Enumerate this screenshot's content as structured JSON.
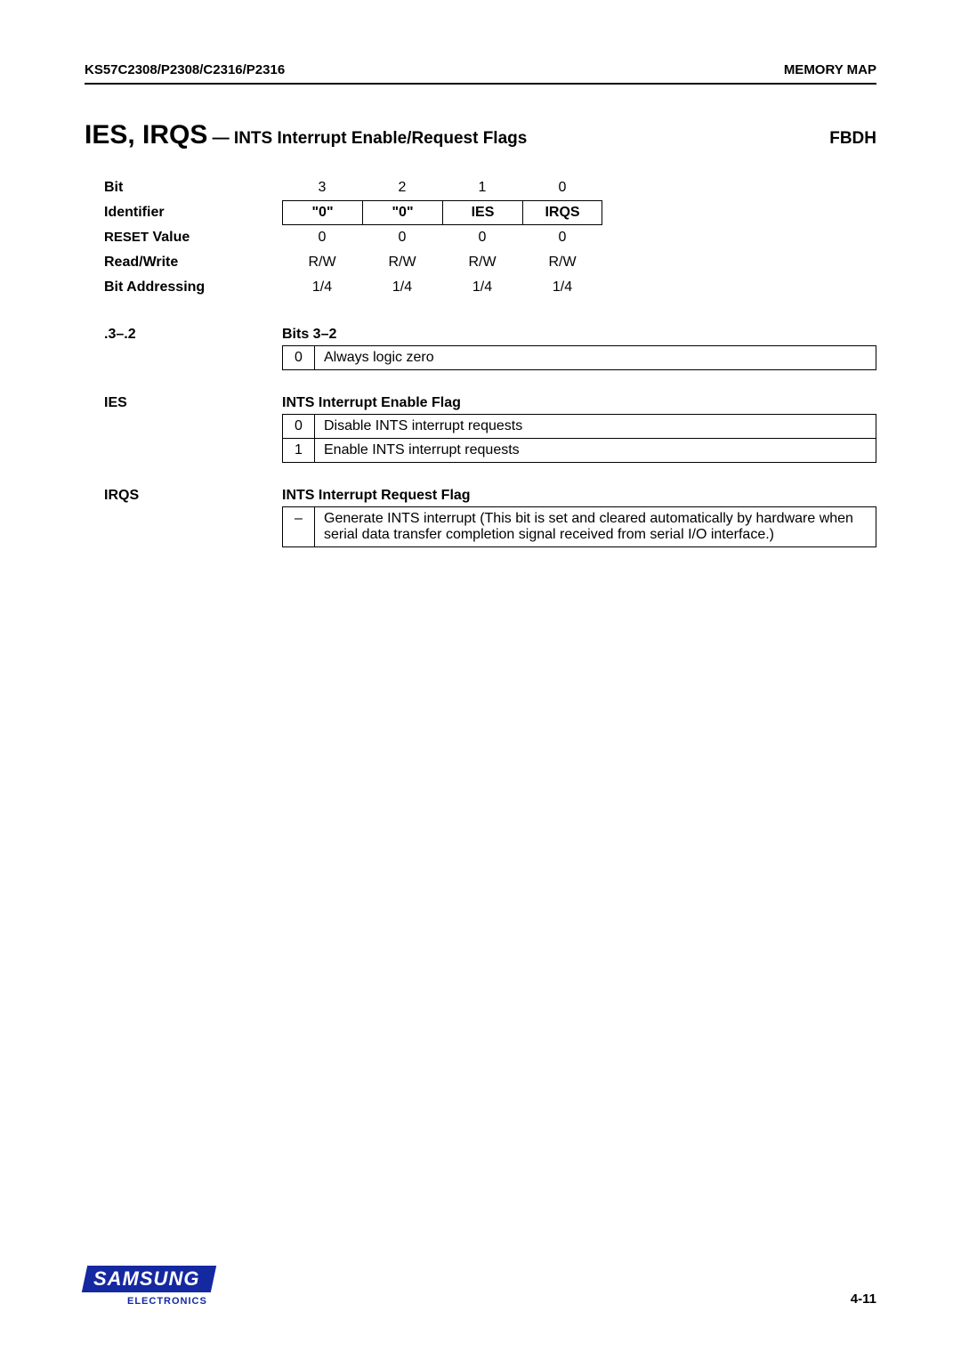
{
  "header": {
    "left": "KS57C2308/P2308/C2316/P2316",
    "right": "MEMORY MAP"
  },
  "title": {
    "big": "IES, IRQS",
    "sub": " — INTS Interrupt Enable/Request Flags",
    "addr": "FBDH"
  },
  "bit_table": {
    "rows": [
      {
        "label": "Bit",
        "cells": [
          "3",
          "2",
          "1",
          "0"
        ]
      },
      {
        "label": "Identifier",
        "cells": [
          "\"0\"",
          "\"0\"",
          "IES",
          "IRQS"
        ]
      },
      {
        "label_reset": "RESET",
        "label_value": " Value",
        "cells": [
          "0",
          "0",
          "0",
          "0"
        ]
      },
      {
        "label": "Read/Write",
        "cells": [
          "R/W",
          "R/W",
          "R/W",
          "R/W"
        ]
      },
      {
        "label": "Bit Addressing",
        "cells": [
          "1/4",
          "1/4",
          "1/4",
          "1/4"
        ]
      }
    ]
  },
  "sections": [
    {
      "key": ".3–.2",
      "title": "Bits 3–2",
      "rows": [
        {
          "val": "0",
          "desc": "Always logic zero"
        }
      ]
    },
    {
      "key": "IES",
      "title": "INTS Interrupt Enable Flag",
      "rows": [
        {
          "val": "0",
          "desc": "Disable INTS interrupt requests"
        },
        {
          "val": "1",
          "desc": "Enable INTS interrupt requests"
        }
      ]
    },
    {
      "key": "IRQS",
      "title": "INTS Interrupt Request Flag",
      "rows": [
        {
          "val": "–",
          "desc": "Generate INTS interrupt (This bit is set and cleared automatically by hardware when serial data transfer completion signal received from serial I/O interface.)"
        }
      ]
    }
  ],
  "footer": {
    "logo_word": "SAMSUNG",
    "logo_sub": "ELECTRONICS",
    "pagenum": "4-11"
  }
}
